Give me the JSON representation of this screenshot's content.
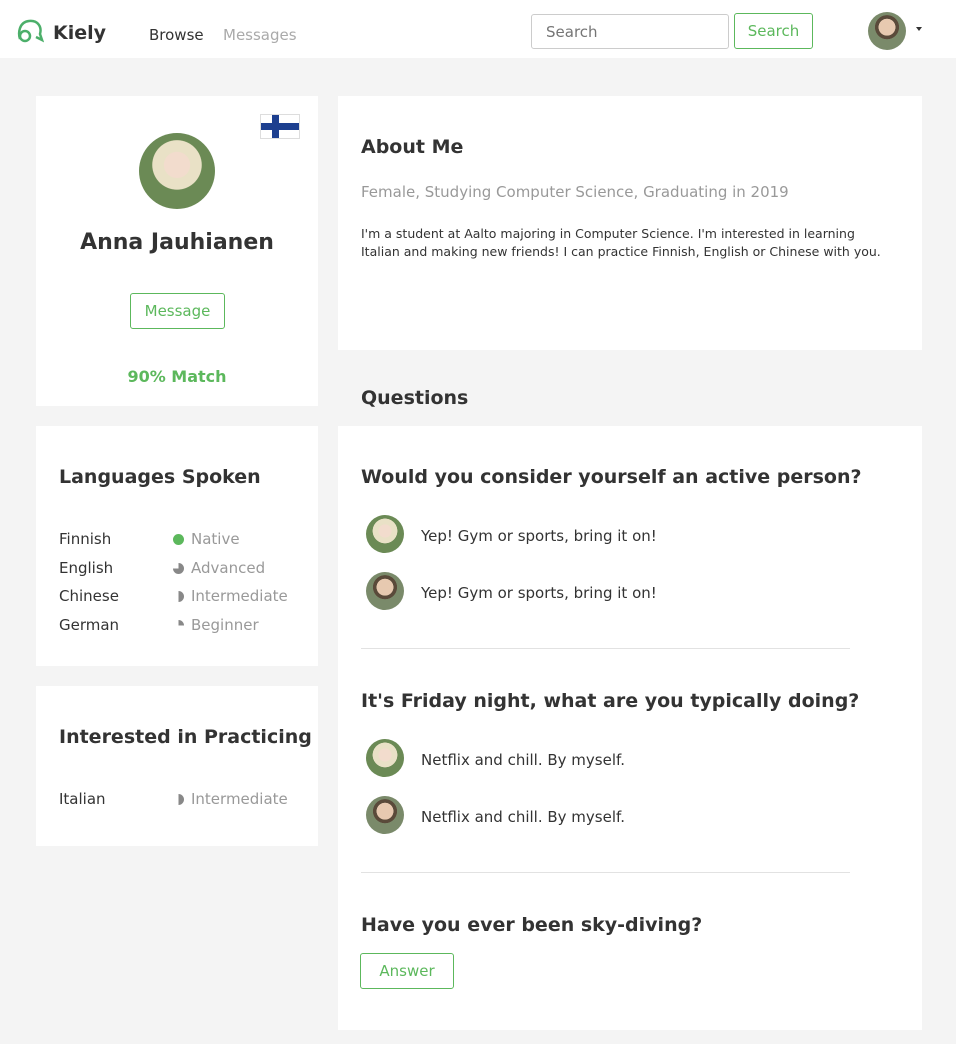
{
  "header": {
    "brand": "Kiely",
    "nav": [
      "Browse",
      "Messages"
    ],
    "search_placeholder": "Search",
    "search_button": "Search"
  },
  "profile": {
    "name": "Anna Jauhianen",
    "message_button": "Message",
    "match": "90% Match",
    "flag": "finland-flag"
  },
  "languages": {
    "title": "Languages Spoken",
    "items": [
      {
        "name": "Finnish",
        "level": "Native",
        "fill": 1
      },
      {
        "name": "English",
        "level": "Advanced",
        "fill": 0.75
      },
      {
        "name": "Chinese",
        "level": "Intermediate",
        "fill": 0.5
      },
      {
        "name": "German",
        "level": "Beginner",
        "fill": 0.25
      }
    ]
  },
  "practicing": {
    "title": "Interested in Practicing",
    "items": [
      {
        "name": "Italian",
        "level": "Intermediate",
        "fill": 0.5
      }
    ]
  },
  "about": {
    "title": "About Me",
    "subtitle": "Female, Studying Computer Science, Graduating in 2019",
    "body": "I'm a student at Aalto majoring in Computer Science. I'm interested in learning Italian and making new friends! I can practice Finnish, English or Chinese with you."
  },
  "questions": {
    "title": "Questions",
    "items": [
      {
        "question": "Would you consider yourself an active person?",
        "answers": [
          "Yep! Gym or sports, bring it on!",
          "Yep! Gym or sports, bring it on!"
        ]
      },
      {
        "question": "It's Friday night, what are you typically doing?",
        "answers": [
          "Netflix and chill. By myself.",
          "Netflix and chill. By myself."
        ]
      },
      {
        "question": "Have you ever been sky-diving?",
        "answer_button": "Answer"
      }
    ]
  },
  "colors": {
    "accent": "#5cb85c",
    "level": "#888888"
  }
}
